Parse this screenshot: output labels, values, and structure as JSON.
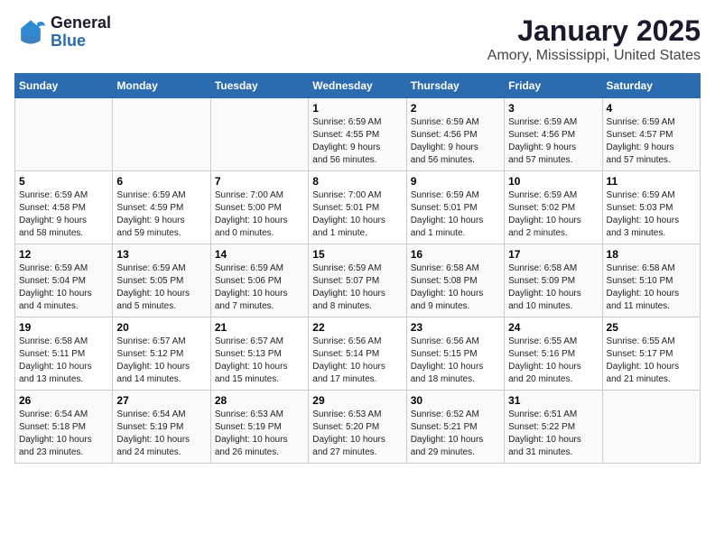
{
  "header": {
    "logo_general": "General",
    "logo_blue": "Blue",
    "title": "January 2025",
    "subtitle": "Amory, Mississippi, United States"
  },
  "days_of_week": [
    "Sunday",
    "Monday",
    "Tuesday",
    "Wednesday",
    "Thursday",
    "Friday",
    "Saturday"
  ],
  "weeks": [
    [
      {
        "day": "",
        "info": ""
      },
      {
        "day": "",
        "info": ""
      },
      {
        "day": "",
        "info": ""
      },
      {
        "day": "1",
        "info": "Sunrise: 6:59 AM\nSunset: 4:55 PM\nDaylight: 9 hours\nand 56 minutes."
      },
      {
        "day": "2",
        "info": "Sunrise: 6:59 AM\nSunset: 4:56 PM\nDaylight: 9 hours\nand 56 minutes."
      },
      {
        "day": "3",
        "info": "Sunrise: 6:59 AM\nSunset: 4:56 PM\nDaylight: 9 hours\nand 57 minutes."
      },
      {
        "day": "4",
        "info": "Sunrise: 6:59 AM\nSunset: 4:57 PM\nDaylight: 9 hours\nand 57 minutes."
      }
    ],
    [
      {
        "day": "5",
        "info": "Sunrise: 6:59 AM\nSunset: 4:58 PM\nDaylight: 9 hours\nand 58 minutes."
      },
      {
        "day": "6",
        "info": "Sunrise: 6:59 AM\nSunset: 4:59 PM\nDaylight: 9 hours\nand 59 minutes."
      },
      {
        "day": "7",
        "info": "Sunrise: 7:00 AM\nSunset: 5:00 PM\nDaylight: 10 hours\nand 0 minutes."
      },
      {
        "day": "8",
        "info": "Sunrise: 7:00 AM\nSunset: 5:01 PM\nDaylight: 10 hours\nand 1 minute."
      },
      {
        "day": "9",
        "info": "Sunrise: 6:59 AM\nSunset: 5:01 PM\nDaylight: 10 hours\nand 1 minute."
      },
      {
        "day": "10",
        "info": "Sunrise: 6:59 AM\nSunset: 5:02 PM\nDaylight: 10 hours\nand 2 minutes."
      },
      {
        "day": "11",
        "info": "Sunrise: 6:59 AM\nSunset: 5:03 PM\nDaylight: 10 hours\nand 3 minutes."
      }
    ],
    [
      {
        "day": "12",
        "info": "Sunrise: 6:59 AM\nSunset: 5:04 PM\nDaylight: 10 hours\nand 4 minutes."
      },
      {
        "day": "13",
        "info": "Sunrise: 6:59 AM\nSunset: 5:05 PM\nDaylight: 10 hours\nand 5 minutes."
      },
      {
        "day": "14",
        "info": "Sunrise: 6:59 AM\nSunset: 5:06 PM\nDaylight: 10 hours\nand 7 minutes."
      },
      {
        "day": "15",
        "info": "Sunrise: 6:59 AM\nSunset: 5:07 PM\nDaylight: 10 hours\nand 8 minutes."
      },
      {
        "day": "16",
        "info": "Sunrise: 6:58 AM\nSunset: 5:08 PM\nDaylight: 10 hours\nand 9 minutes."
      },
      {
        "day": "17",
        "info": "Sunrise: 6:58 AM\nSunset: 5:09 PM\nDaylight: 10 hours\nand 10 minutes."
      },
      {
        "day": "18",
        "info": "Sunrise: 6:58 AM\nSunset: 5:10 PM\nDaylight: 10 hours\nand 11 minutes."
      }
    ],
    [
      {
        "day": "19",
        "info": "Sunrise: 6:58 AM\nSunset: 5:11 PM\nDaylight: 10 hours\nand 13 minutes."
      },
      {
        "day": "20",
        "info": "Sunrise: 6:57 AM\nSunset: 5:12 PM\nDaylight: 10 hours\nand 14 minutes."
      },
      {
        "day": "21",
        "info": "Sunrise: 6:57 AM\nSunset: 5:13 PM\nDaylight: 10 hours\nand 15 minutes."
      },
      {
        "day": "22",
        "info": "Sunrise: 6:56 AM\nSunset: 5:14 PM\nDaylight: 10 hours\nand 17 minutes."
      },
      {
        "day": "23",
        "info": "Sunrise: 6:56 AM\nSunset: 5:15 PM\nDaylight: 10 hours\nand 18 minutes."
      },
      {
        "day": "24",
        "info": "Sunrise: 6:55 AM\nSunset: 5:16 PM\nDaylight: 10 hours\nand 20 minutes."
      },
      {
        "day": "25",
        "info": "Sunrise: 6:55 AM\nSunset: 5:17 PM\nDaylight: 10 hours\nand 21 minutes."
      }
    ],
    [
      {
        "day": "26",
        "info": "Sunrise: 6:54 AM\nSunset: 5:18 PM\nDaylight: 10 hours\nand 23 minutes."
      },
      {
        "day": "27",
        "info": "Sunrise: 6:54 AM\nSunset: 5:19 PM\nDaylight: 10 hours\nand 24 minutes."
      },
      {
        "day": "28",
        "info": "Sunrise: 6:53 AM\nSunset: 5:19 PM\nDaylight: 10 hours\nand 26 minutes."
      },
      {
        "day": "29",
        "info": "Sunrise: 6:53 AM\nSunset: 5:20 PM\nDaylight: 10 hours\nand 27 minutes."
      },
      {
        "day": "30",
        "info": "Sunrise: 6:52 AM\nSunset: 5:21 PM\nDaylight: 10 hours\nand 29 minutes."
      },
      {
        "day": "31",
        "info": "Sunrise: 6:51 AM\nSunset: 5:22 PM\nDaylight: 10 hours\nand 31 minutes."
      },
      {
        "day": "",
        "info": ""
      }
    ]
  ]
}
